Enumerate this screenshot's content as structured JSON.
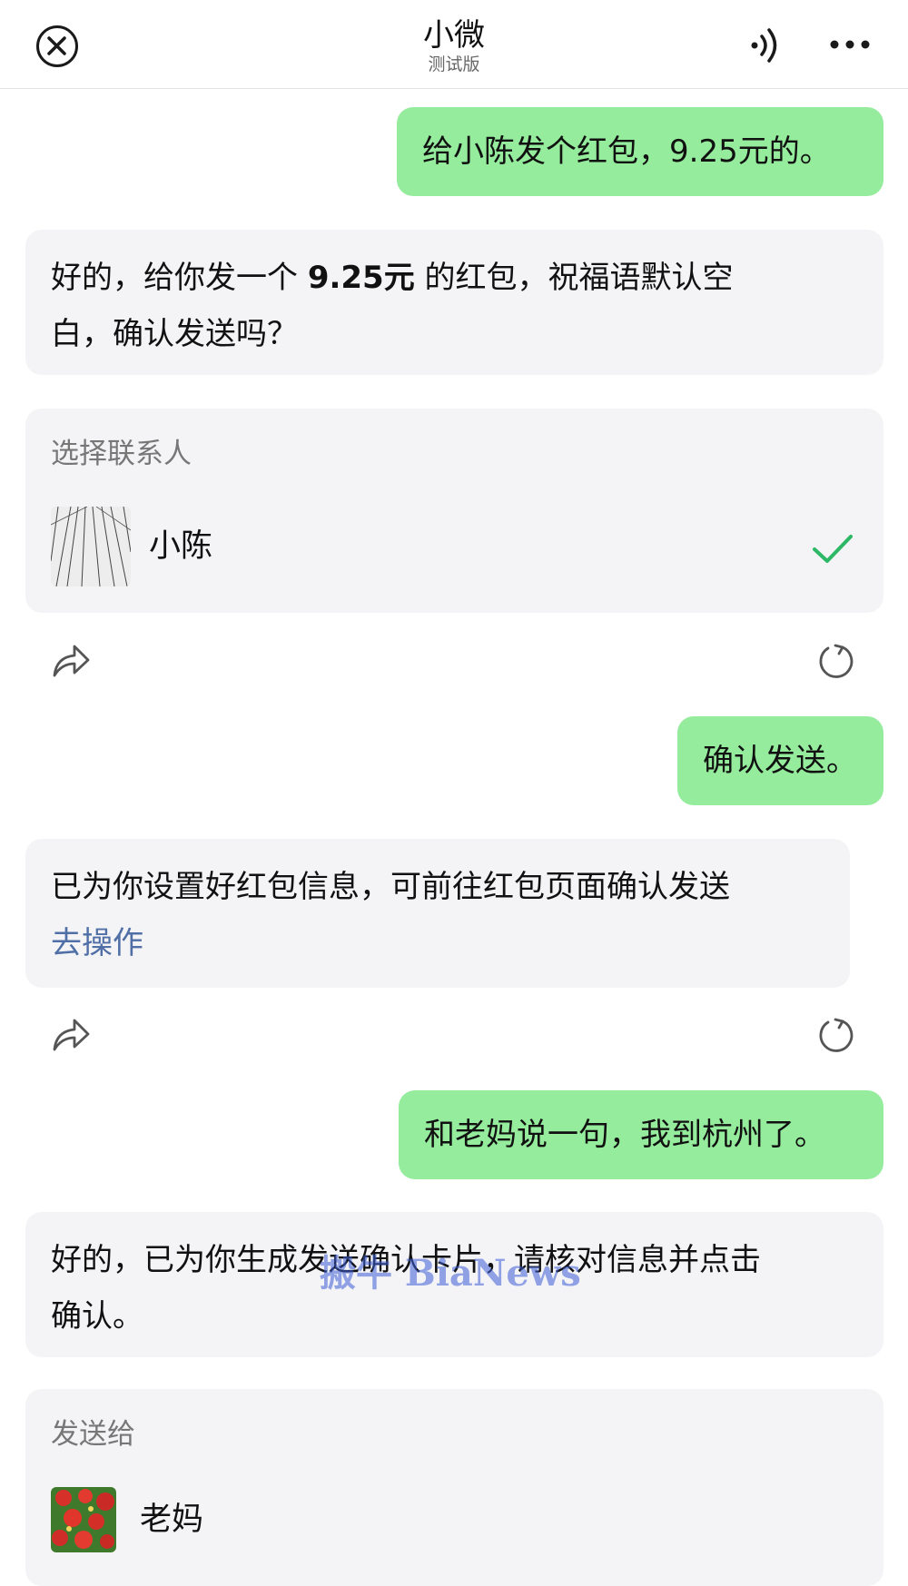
{
  "header": {
    "title": "小微",
    "subtitle": "测试版",
    "close_icon": "close-circle-icon",
    "voice_icon": "speaker-icon",
    "more_icon": "more-dots-icon"
  },
  "colors": {
    "user_bubble": "#95ec9d",
    "bot_bubble": "#f4f4f6",
    "link": "#4f6fa6",
    "check": "#2db865"
  },
  "messages": {
    "m1_user": "给小陈发个红包，9.25元的。",
    "m2_bot_prefix": "好的，给你发一个 ",
    "m2_bot_amount": "9.25元",
    "m2_bot_suffix_line1": " 的红包，祝福语默认空",
    "m2_bot_line2": "白，确认发送吗？",
    "m3_card": {
      "title": "选择联系人",
      "contact_name": "小陈",
      "selected_icon": "check-icon"
    },
    "m4_user": "确认发送。",
    "m5_bot_text": "已为你设置好红包信息，可前往红包页面确认发送",
    "m5_bot_link": "去操作",
    "m6_user": "和老妈说一句，我到杭州了。",
    "m7_bot_line1": "好的，已为你生成发送确认卡片，请核对信息并点击",
    "m7_bot_line2": "确认。",
    "m8_card": {
      "title": "发送给",
      "contact_name": "老妈"
    }
  },
  "watermark": "搬牛 BiaNews"
}
